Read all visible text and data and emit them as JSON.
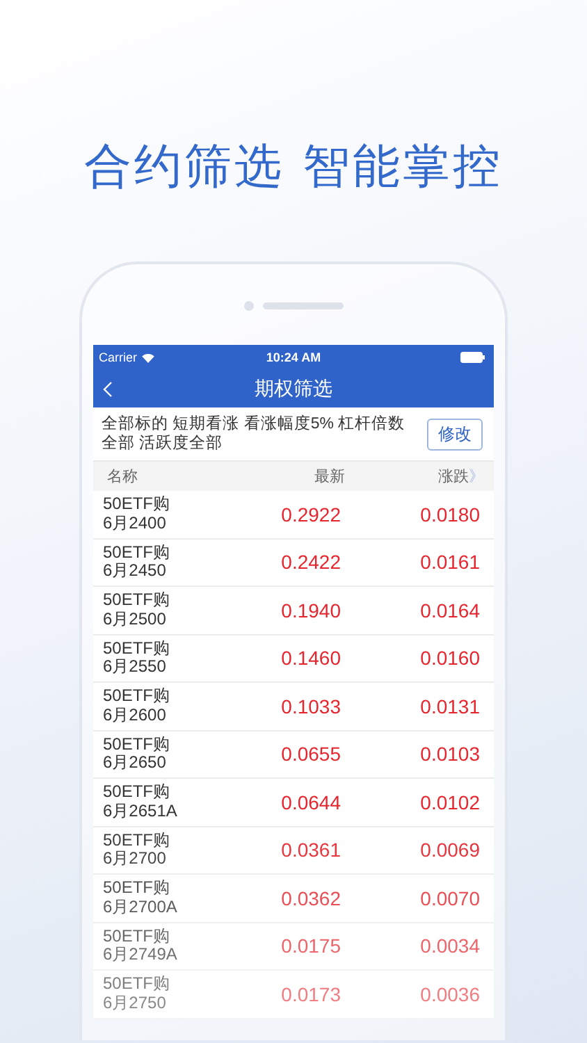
{
  "headline": "合约筛选 智能掌控",
  "status_bar": {
    "carrier": "Carrier",
    "time": "10:24 AM"
  },
  "nav": {
    "title": "期权筛选"
  },
  "filter": {
    "summary": "全部标的 短期看涨 看涨幅度5% 杠杆倍数全部 活跃度全部",
    "button": "修改"
  },
  "columns": [
    "名称",
    "最新",
    "涨跌"
  ],
  "more_columns": "》",
  "rows": [
    {
      "name": "50ETF购",
      "contract": "6月2400",
      "last": "0.2922",
      "change": "0.0180"
    },
    {
      "name": "50ETF购",
      "contract": "6月2450",
      "last": "0.2422",
      "change": "0.0161"
    },
    {
      "name": "50ETF购",
      "contract": "6月2500",
      "last": "0.1940",
      "change": "0.0164"
    },
    {
      "name": "50ETF购",
      "contract": "6月2550",
      "last": "0.1460",
      "change": "0.0160"
    },
    {
      "name": "50ETF购",
      "contract": "6月2600",
      "last": "0.1033",
      "change": "0.0131"
    },
    {
      "name": "50ETF购",
      "contract": "6月2650",
      "last": "0.0655",
      "change": "0.0103"
    },
    {
      "name": "50ETF购",
      "contract": "6月2651A",
      "last": "0.0644",
      "change": "0.0102"
    },
    {
      "name": "50ETF购",
      "contract": "6月2700",
      "last": "0.0361",
      "change": "0.0069"
    },
    {
      "name": "50ETF购",
      "contract": "6月2700A",
      "last": "0.0362",
      "change": "0.0070"
    },
    {
      "name": "50ETF购",
      "contract": "6月2749A",
      "last": "0.0175",
      "change": "0.0034"
    },
    {
      "name": "50ETF购",
      "contract": "6月2750",
      "last": "0.0173",
      "change": "0.0036"
    }
  ]
}
